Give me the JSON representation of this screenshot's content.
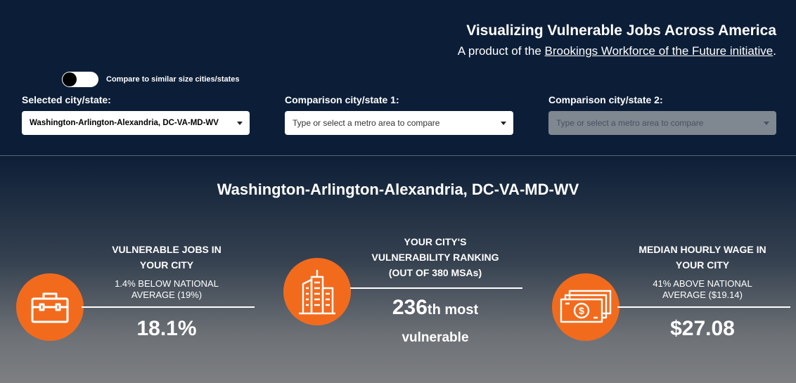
{
  "header": {
    "title": "Visualizing Vulnerable Jobs Across America",
    "subtitle_prefix": "A product of the ",
    "subtitle_link": "Brookings Workforce of the Future initiative",
    "subtitle_suffix": "."
  },
  "compare_toggle": {
    "label": "Compare to similar size cities/states",
    "on": false
  },
  "selectors": {
    "selected": {
      "label": "Selected city/state:",
      "value": "Washington-Arlington-Alexandria, DC-VA-MD-WV"
    },
    "comparison1": {
      "label": "Comparison city/state 1:",
      "placeholder": "Type or select a metro area to compare"
    },
    "comparison2": {
      "label": "Comparison city/state 2:",
      "placeholder": "Type or select a metro area to compare"
    }
  },
  "metro_title": "Washington-Arlington-Alexandria, DC-VA-MD-WV",
  "stats": {
    "vulnerable_jobs": {
      "head_line1": "VULNERABLE JOBS IN",
      "head_line2": "YOUR CITY",
      "sub_line1": "1.4% BELOW NATIONAL",
      "sub_line2": "AVERAGE (19%)",
      "value": "18.1%",
      "icon": "briefcase-icon"
    },
    "ranking": {
      "head_line1": "YOUR CITY'S",
      "head_line2": "VULNERABILITY RANKING",
      "head_line3": "(OUT OF 380 MSAs)",
      "value_number": "236",
      "value_suffix": "th most",
      "value_line2": "vulnerable",
      "icon": "city-buildings-icon"
    },
    "wage": {
      "head_line1": "MEDIAN HOURLY WAGE IN",
      "head_line2": "YOUR CITY",
      "sub_line1": "41% ABOVE NATIONAL",
      "sub_line2": "AVERAGE ($19.14)",
      "value": "$27.08",
      "icon": "money-bills-icon"
    }
  },
  "colors": {
    "accent": "#f26b1d",
    "header_bg": "#0c1e37"
  }
}
